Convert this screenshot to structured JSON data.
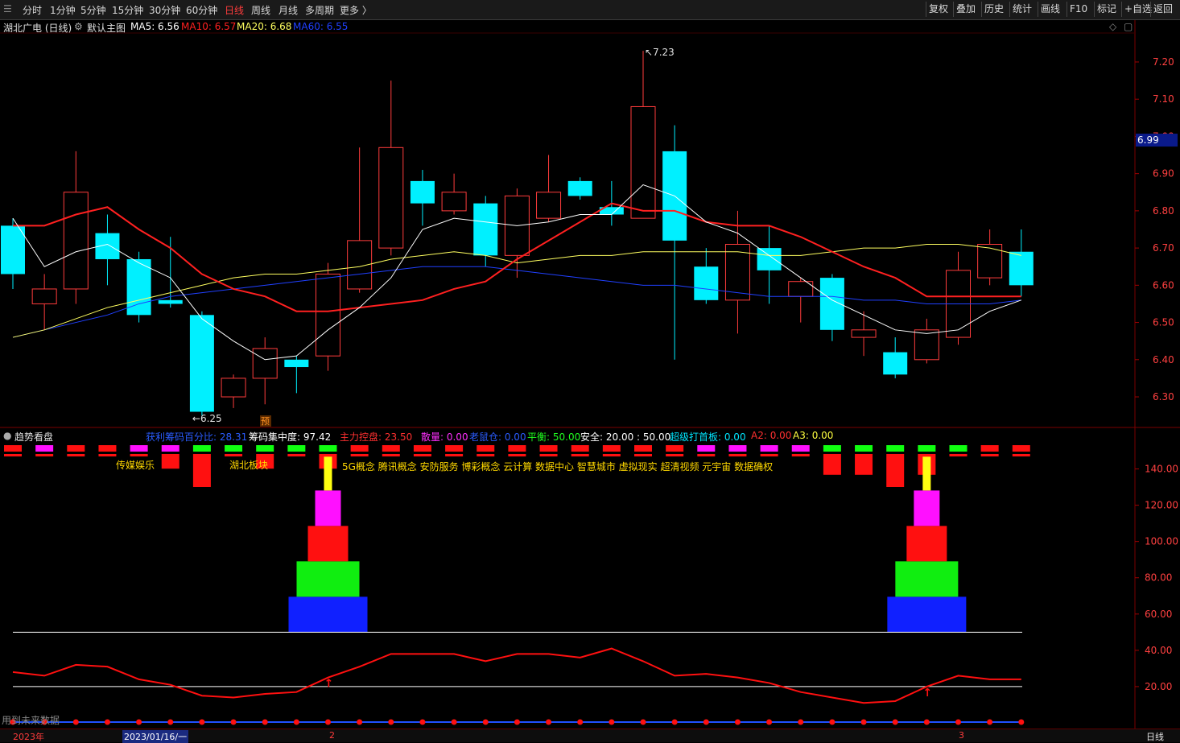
{
  "toolbar": {
    "periods": [
      "分时",
      "1分钟",
      "5分钟",
      "15分钟",
      "30分钟",
      "60分钟",
      "日线",
      "周线",
      "月线",
      "多周期",
      "更多 〉"
    ],
    "active": "日线",
    "right_buttons": [
      "复权",
      "叠加",
      "历史",
      "统计",
      "画线",
      "F10",
      "标记",
      "+自选",
      "返回"
    ]
  },
  "price_panel": {
    "stock_title": "湖北广电 (日线)",
    "main_chart_label": "默认主图",
    "ma5": "MA5: 6.56",
    "ma10": "MA10: 6.57",
    "ma20": "MA20: 6.68",
    "ma60": "MA60: 6.55",
    "y_ticks": [
      "7.20",
      "7.10",
      "7.00",
      "6.90",
      "6.80",
      "6.70",
      "6.60",
      "6.50",
      "6.40",
      "6.30"
    ],
    "current_price": "6.99",
    "high_label": "7.23",
    "low_label": "6.25",
    "forecast_badge": "预"
  },
  "indicator_panel": {
    "title": "趋势看盘",
    "metrics": [
      {
        "label": "获利筹码百分比: 28.31",
        "color": "#2a5cff"
      },
      {
        "label": "筹码集中度: 97.42",
        "color": "#ffffff"
      },
      {
        "label": "主力控盘: 23.50",
        "color": "#ff3030"
      },
      {
        "label": "散量: 0.00",
        "color": "#ff30ff"
      },
      {
        "label": "老鼠仓: 0.00",
        "color": "#2a5cff"
      },
      {
        "label": "平衡: 50.00",
        "color": "#20ff20"
      },
      {
        "label": "安全: 20.00 : 50.00",
        "color": "#ffffff"
      },
      {
        "label": "超级打首板: 0.00",
        "color": "#00e6ff"
      },
      {
        "label": "A2: 0.00",
        "color": "#ff3030"
      },
      {
        "label": "A3: 0.00",
        "color": "#ffff40"
      }
    ],
    "sector_labels": [
      "传媒娱乐",
      "湖北板块"
    ],
    "concepts": "5G概念 腾讯概念 安防服务 博彩概念 云计算 数据中心 智慧城市 虚拟现实 超清视频 元宇宙 数据确权",
    "y_ticks": [
      "140.00",
      "120.00",
      "100.00",
      "80.00",
      "60.00",
      "40.00",
      "20.00"
    ],
    "future_data_text": "用到未来数据"
  },
  "bottom_bar": {
    "year": "2023年",
    "date": "2023/01/16/一",
    "month2": "2",
    "month3": "3",
    "period": "日线"
  },
  "colors": {
    "up": "#ff3c3c",
    "down": "#00f0ff",
    "ma5": "#ffffff",
    "ma10": "#ff2020",
    "ma20": "#ffff60",
    "ma60": "#2040ff"
  },
  "chart_data": {
    "type": "candlestick",
    "candles": [
      {
        "o": 6.63,
        "c": 6.76,
        "h": 6.78,
        "l": 6.59,
        "dir": "down"
      },
      {
        "o": 6.55,
        "c": 6.59,
        "h": 6.63,
        "l": 6.48,
        "dir": "up"
      },
      {
        "o": 6.59,
        "c": 6.85,
        "h": 6.96,
        "l": 6.55,
        "dir": "up"
      },
      {
        "o": 6.74,
        "c": 6.67,
        "h": 6.79,
        "l": 6.6,
        "dir": "down"
      },
      {
        "o": 6.67,
        "c": 6.52,
        "h": 6.69,
        "l": 6.5,
        "dir": "down"
      },
      {
        "o": 6.56,
        "c": 6.55,
        "h": 6.73,
        "l": 6.54,
        "dir": "down"
      },
      {
        "o": 6.52,
        "c": 6.26,
        "h": 6.53,
        "l": 6.25,
        "dir": "down"
      },
      {
        "o": 6.3,
        "c": 6.35,
        "h": 6.36,
        "l": 6.27,
        "dir": "up"
      },
      {
        "o": 6.35,
        "c": 6.43,
        "h": 6.46,
        "l": 6.28,
        "dir": "up"
      },
      {
        "o": 6.4,
        "c": 6.38,
        "h": 6.41,
        "l": 6.31,
        "dir": "down"
      },
      {
        "o": 6.41,
        "c": 6.63,
        "h": 6.66,
        "l": 6.37,
        "dir": "up"
      },
      {
        "o": 6.59,
        "c": 6.72,
        "h": 6.97,
        "l": 6.58,
        "dir": "up"
      },
      {
        "o": 6.7,
        "c": 6.97,
        "h": 7.15,
        "l": 6.68,
        "dir": "up"
      },
      {
        "o": 6.88,
        "c": 6.82,
        "h": 6.91,
        "l": 6.76,
        "dir": "down"
      },
      {
        "o": 6.8,
        "c": 6.85,
        "h": 6.9,
        "l": 6.79,
        "dir": "up"
      },
      {
        "o": 6.82,
        "c": 6.68,
        "h": 6.84,
        "l": 6.65,
        "dir": "down"
      },
      {
        "o": 6.68,
        "c": 6.84,
        "h": 6.86,
        "l": 6.62,
        "dir": "up"
      },
      {
        "o": 6.78,
        "c": 6.85,
        "h": 6.95,
        "l": 6.77,
        "dir": "up"
      },
      {
        "o": 6.88,
        "c": 6.84,
        "h": 6.89,
        "l": 6.83,
        "dir": "down"
      },
      {
        "o": 6.81,
        "c": 6.79,
        "h": 6.88,
        "l": 6.76,
        "dir": "down"
      },
      {
        "o": 6.78,
        "c": 7.08,
        "h": 7.23,
        "l": 6.78,
        "dir": "up"
      },
      {
        "o": 6.96,
        "c": 6.72,
        "h": 7.03,
        "l": 6.4,
        "dir": "down"
      },
      {
        "o": 6.65,
        "c": 6.56,
        "h": 6.7,
        "l": 6.55,
        "dir": "down"
      },
      {
        "o": 6.56,
        "c": 6.71,
        "h": 6.8,
        "l": 6.47,
        "dir": "up"
      },
      {
        "o": 6.7,
        "c": 6.64,
        "h": 6.76,
        "l": 6.55,
        "dir": "down"
      },
      {
        "o": 6.57,
        "c": 6.61,
        "h": 6.62,
        "l": 6.5,
        "dir": "up"
      },
      {
        "o": 6.62,
        "c": 6.48,
        "h": 6.63,
        "l": 6.45,
        "dir": "down"
      },
      {
        "o": 6.46,
        "c": 6.48,
        "h": 6.53,
        "l": 6.41,
        "dir": "up"
      },
      {
        "o": 6.42,
        "c": 6.36,
        "h": 6.46,
        "l": 6.35,
        "dir": "down"
      },
      {
        "o": 6.4,
        "c": 6.48,
        "h": 6.51,
        "l": 6.39,
        "dir": "up"
      },
      {
        "o": 6.46,
        "c": 6.64,
        "h": 6.69,
        "l": 6.44,
        "dir": "up"
      },
      {
        "o": 6.62,
        "c": 6.71,
        "h": 6.75,
        "l": 6.6,
        "dir": "up"
      },
      {
        "o": 6.69,
        "c": 6.6,
        "h": 6.75,
        "l": 6.57,
        "dir": "down"
      }
    ],
    "ma5": [
      6.78,
      6.65,
      6.69,
      6.71,
      6.66,
      6.62,
      6.51,
      6.45,
      6.4,
      6.41,
      6.48,
      6.54,
      6.62,
      6.75,
      6.78,
      6.77,
      6.76,
      6.77,
      6.79,
      6.79,
      6.87,
      6.84,
      6.77,
      6.74,
      6.68,
      6.62,
      6.56,
      6.52,
      6.48,
      6.47,
      6.48,
      6.53,
      6.56
    ],
    "ma10": [
      6.76,
      6.76,
      6.79,
      6.81,
      6.75,
      6.7,
      6.63,
      6.59,
      6.57,
      6.53,
      6.53,
      6.54,
      6.55,
      6.56,
      6.59,
      6.61,
      6.67,
      6.72,
      6.77,
      6.82,
      6.8,
      6.8,
      6.77,
      6.76,
      6.76,
      6.73,
      6.69,
      6.65,
      6.62,
      6.57,
      6.57,
      6.57,
      6.57
    ],
    "ma20": [
      6.46,
      6.48,
      6.51,
      6.54,
      6.56,
      6.58,
      6.6,
      6.62,
      6.63,
      6.63,
      6.64,
      6.65,
      6.67,
      6.68,
      6.69,
      6.68,
      6.66,
      6.67,
      6.68,
      6.68,
      6.69,
      6.69,
      6.69,
      6.69,
      6.68,
      6.68,
      6.69,
      6.7,
      6.7,
      6.71,
      6.71,
      6.7,
      6.68
    ],
    "ma60": [
      6.46,
      6.48,
      6.5,
      6.52,
      6.55,
      6.57,
      6.58,
      6.59,
      6.6,
      6.61,
      6.62,
      6.63,
      6.64,
      6.65,
      6.65,
      6.65,
      6.64,
      6.63,
      6.62,
      6.61,
      6.6,
      6.6,
      6.59,
      6.58,
      6.57,
      6.57,
      6.57,
      6.56,
      6.56,
      6.55,
      6.55,
      6.55,
      6.56
    ],
    "price_ylim": [
      6.22,
      7.28
    ],
    "signal_top_colors": [
      "red",
      "magenta",
      "red",
      "red",
      "magenta",
      "magenta",
      "green",
      "green",
      "green",
      "green",
      "green",
      "red",
      "red",
      "red",
      "red",
      "red",
      "red",
      "red",
      "red",
      "red",
      "red",
      "red",
      "magenta",
      "magenta",
      "magenta",
      "magenta",
      "green",
      "green",
      "green",
      "green",
      "green",
      "red",
      "red"
    ],
    "signal_bar_lengths": [
      0,
      0,
      0,
      0,
      0,
      0.4,
      1,
      0,
      0.4,
      0,
      0.4,
      0,
      0,
      0,
      0,
      0,
      0,
      0,
      0,
      0,
      0,
      0,
      0,
      0,
      0,
      0,
      0.6,
      0.6,
      1,
      0.6,
      0,
      0,
      0
    ],
    "trend_line": [
      28,
      26,
      32,
      31,
      24,
      21,
      15,
      14,
      16,
      17,
      25,
      31,
      38,
      38,
      38,
      34,
      38,
      38,
      36,
      41,
      34,
      26,
      27,
      25,
      22,
      17,
      14,
      11,
      12,
      20,
      26,
      24,
      24
    ],
    "indicator_ylim": [
      0,
      150
    ],
    "baseline_60": 50,
    "baseline_20": 20,
    "pyramids": [
      {
        "index": 10
      },
      {
        "index": 29
      }
    ],
    "arrow_indices": [
      10,
      29
    ]
  }
}
